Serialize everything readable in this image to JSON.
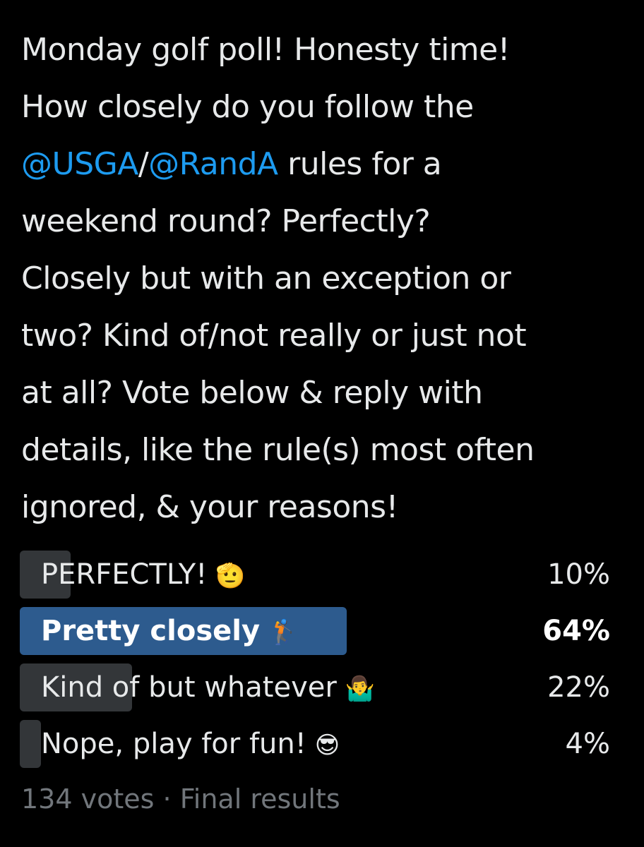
{
  "tweet": {
    "lines": [
      {
        "text": "Monday golf poll! Honesty time!"
      },
      {
        "text": "How closely do you follow the"
      },
      {
        "mention1": "@USGA",
        "sep": "/",
        "mention2": "@RandA",
        "rest": " rules for a"
      },
      {
        "text": "weekend round? Perfectly?"
      },
      {
        "text": "Closely but with an exception or"
      },
      {
        "text": "two? Kind of/not really or just not"
      },
      {
        "text": "at all? Vote below & reply with"
      },
      {
        "text": "details, like the rule(s) most often"
      },
      {
        "text": "ignored, & your reasons!"
      }
    ]
  },
  "poll": {
    "options": [
      {
        "label": "PERFECTLY!",
        "emoji": "🫡",
        "icon": "saluting-face-icon",
        "percent": "10%",
        "share": 0.1,
        "winner": false
      },
      {
        "label": "Pretty closely",
        "emoji": "🏌️",
        "icon": "golfer-icon",
        "percent": "64%",
        "share": 0.64,
        "winner": true
      },
      {
        "label": "Kind of but whatever",
        "emoji": "🤷‍♂️",
        "icon": "shrug-icon",
        "percent": "22%",
        "share": 0.22,
        "winner": false
      },
      {
        "label": "Nope, play for fun!",
        "emoji": "😎",
        "icon": "sunglasses-face-icon",
        "percent": "4%",
        "share": 0.04,
        "winner": false
      }
    ],
    "votes": "134 votes",
    "separator": " · ",
    "status": "Final results"
  },
  "colors": {
    "background": "#000000",
    "text": "#e7e9ea",
    "mention": "#1d9bf0",
    "bar": "#333639",
    "winner_bar": "#2d5b8e",
    "muted": "#71767b"
  }
}
